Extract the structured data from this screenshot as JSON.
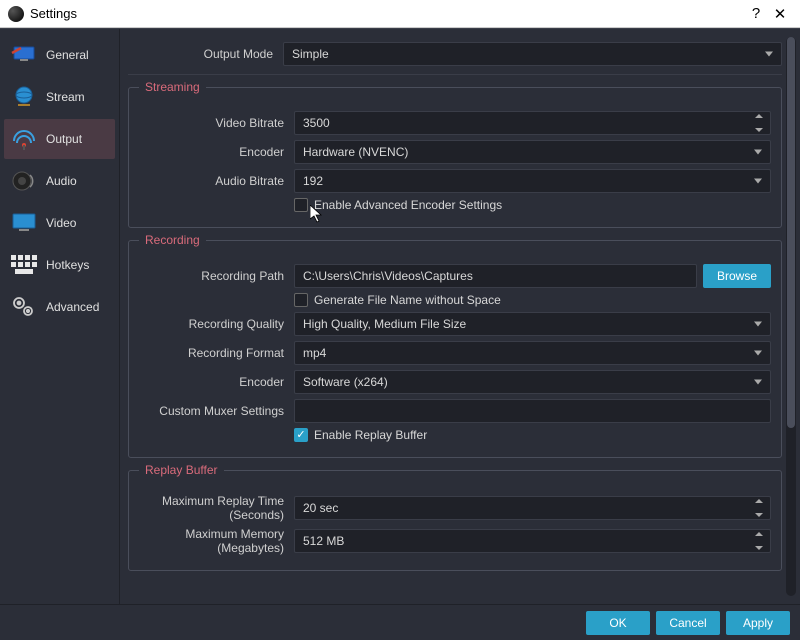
{
  "window": {
    "title": "Settings"
  },
  "sidebar": {
    "items": [
      {
        "label": "General"
      },
      {
        "label": "Stream"
      },
      {
        "label": "Output"
      },
      {
        "label": "Audio"
      },
      {
        "label": "Video"
      },
      {
        "label": "Hotkeys"
      },
      {
        "label": "Advanced"
      }
    ],
    "active_index": 2
  },
  "output_mode": {
    "label": "Output Mode",
    "value": "Simple"
  },
  "streaming": {
    "title": "Streaming",
    "video_bitrate": {
      "label": "Video Bitrate",
      "value": "3500"
    },
    "encoder": {
      "label": "Encoder",
      "value": "Hardware (NVENC)"
    },
    "audio_bitrate": {
      "label": "Audio Bitrate",
      "value": "192"
    },
    "advanced_checkbox": {
      "label": "Enable Advanced Encoder Settings",
      "checked": false
    }
  },
  "recording": {
    "title": "Recording",
    "path": {
      "label": "Recording Path",
      "value": "C:\\Users\\Chris\\Videos\\Captures"
    },
    "browse": "Browse",
    "nospace_checkbox": {
      "label": "Generate File Name without Space",
      "checked": false
    },
    "quality": {
      "label": "Recording Quality",
      "value": "High Quality, Medium File Size"
    },
    "format": {
      "label": "Recording Format",
      "value": "mp4"
    },
    "encoder": {
      "label": "Encoder",
      "value": "Software (x264)"
    },
    "muxer": {
      "label": "Custom Muxer Settings",
      "value": ""
    },
    "replay_checkbox": {
      "label": "Enable Replay Buffer",
      "checked": true
    }
  },
  "replay_buffer": {
    "title": "Replay Buffer",
    "max_time": {
      "label": "Maximum Replay Time (Seconds)",
      "value": "20 sec"
    },
    "max_memory": {
      "label": "Maximum Memory (Megabytes)",
      "value": "512 MB"
    }
  },
  "footer": {
    "ok": "OK",
    "cancel": "Cancel",
    "apply": "Apply"
  }
}
